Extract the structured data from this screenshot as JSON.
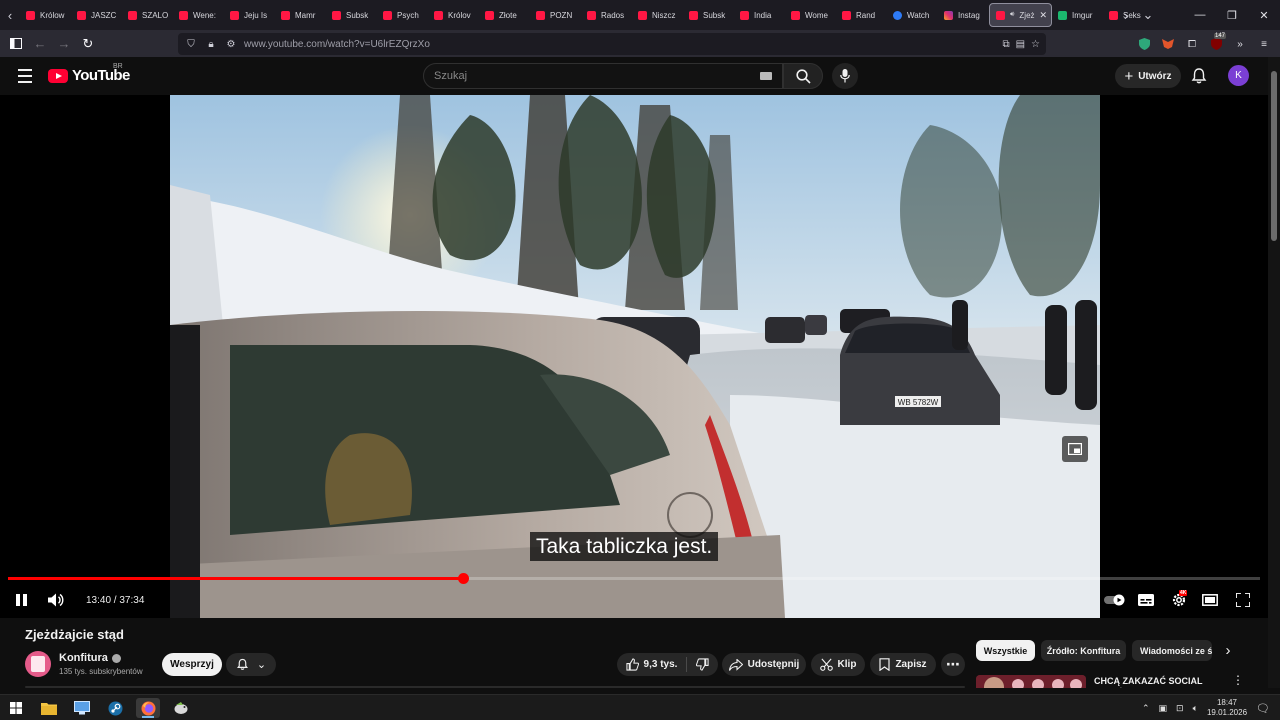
{
  "browser": {
    "tabs": [
      {
        "label": "Królow",
        "icon": "youtube-favicon"
      },
      {
        "label": "JASZC",
        "icon": "youtube-favicon"
      },
      {
        "label": "SZALO",
        "icon": "youtube-favicon"
      },
      {
        "label": "Wene:",
        "icon": "youtube-favicon"
      },
      {
        "label": "Jeju Is",
        "icon": "youtube-favicon"
      },
      {
        "label": "Mamr",
        "icon": "youtube-favicon"
      },
      {
        "label": "Subsk",
        "icon": "youtube-favicon"
      },
      {
        "label": "Psych",
        "icon": "youtube-favicon"
      },
      {
        "label": "Królov",
        "icon": "youtube-favicon"
      },
      {
        "label": "Złote",
        "icon": "youtube-favicon"
      },
      {
        "label": "POZN",
        "icon": "youtube-favicon"
      },
      {
        "label": "Rados",
        "icon": "youtube-favicon"
      },
      {
        "label": "Niszcz",
        "icon": "youtube-favicon"
      },
      {
        "label": "Subsk",
        "icon": "youtube-favicon"
      },
      {
        "label": "India",
        "icon": "youtube-favicon"
      },
      {
        "label": "Wome",
        "icon": "youtube-favicon"
      },
      {
        "label": "Rand",
        "icon": "youtube-favicon"
      },
      {
        "label": "Watch",
        "icon": "meta-favicon"
      },
      {
        "label": "Instag",
        "icon": "instagram-favicon"
      },
      {
        "label": "Zjeż",
        "icon": "youtube-favicon",
        "active": true
      },
      {
        "label": "Imgur",
        "icon": "imgur-favicon"
      },
      {
        "label": "Seks",
        "icon": "youtube-favicon"
      }
    ],
    "url": "www.youtube.com/watch?v=U6lrEZQrzXo",
    "extension_badge": "147"
  },
  "youtube": {
    "logo_text": "YouTube",
    "country_code": "BR",
    "search_placeholder": "Szukaj",
    "create_label": "Utwórz",
    "avatar_letter": "K"
  },
  "player": {
    "subtitle": "Taka tabliczka jest.",
    "current_time": "13:40",
    "duration": "37:34",
    "time_display": "13:40 / 37:34",
    "progress_fraction": 0.3637,
    "state": "playing",
    "settings_badge": "4K"
  },
  "video": {
    "title": "Zjeżdżajcie stąd",
    "channel": "Konfitura",
    "subscribers": "135 tys. subskrybentów",
    "join_label": "Wesprzyj",
    "likes": "9,3 tys.",
    "share_label": "Udostępnij",
    "clip_label": "Klip",
    "save_label": "Zapisz"
  },
  "recommendations": {
    "chips": [
      "Wszystkie",
      "Źródło: Konfitura",
      "Wiadomości ze świata"
    ],
    "first_title": "CHCĄ ZAKAZAĆ SOCIAL MEDIÓW DZIECIOM"
  },
  "taskbar": {
    "time": "18:47",
    "date": "19.01.2026"
  },
  "colors": {
    "accent_red": "#ff0000",
    "youtube_bg": "#0f0f0f",
    "browser_chrome": "#1c1b22"
  }
}
